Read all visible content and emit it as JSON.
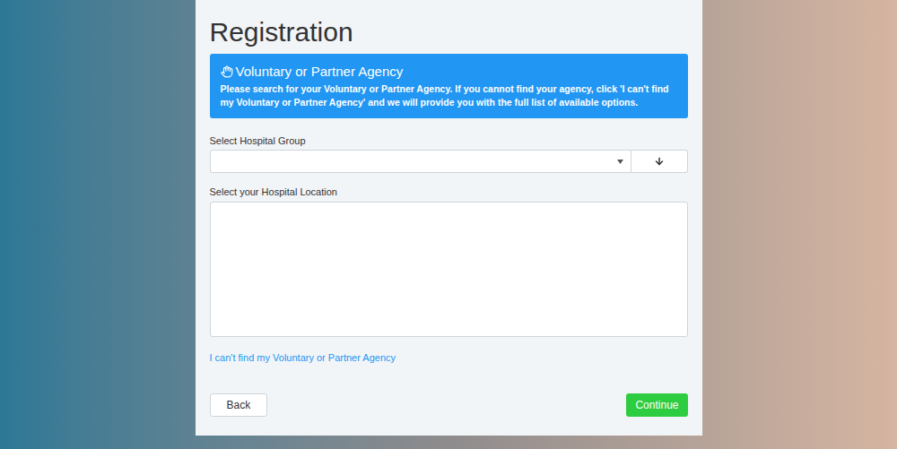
{
  "page": {
    "title": "Registration"
  },
  "notice": {
    "title": "Voluntary or Partner Agency",
    "body": "Please search for your Voluntary or Partner Agency. If you cannot find your agency, click 'I can't find my Voluntary or Partner Agency' and we will provide you with the full list of available options."
  },
  "hospital_group": {
    "label": "Select Hospital Group",
    "value": ""
  },
  "hospital_location": {
    "label": "Select your Hospital Location",
    "options": []
  },
  "link": "I can't find my Voluntary or Partner Agency",
  "buttons": [
    {
      "label": "Back",
      "kind": "secondary"
    },
    {
      "label": "Continue",
      "kind": "primary"
    }
  ]
}
